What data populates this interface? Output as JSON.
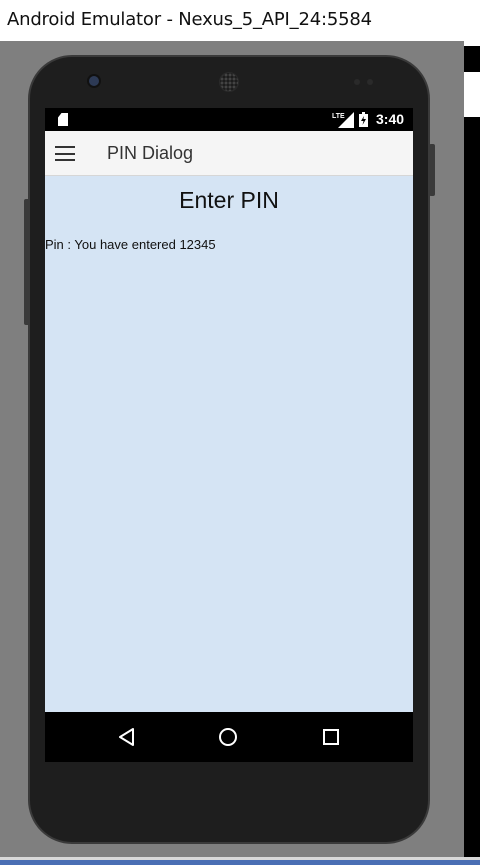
{
  "window": {
    "title": "Android Emulator - Nexus_5_API_24:5584"
  },
  "statusbar": {
    "network_label": "LTE",
    "time": "3:40"
  },
  "appbar": {
    "title": "PIN Dialog",
    "menu_icon": "hamburger-menu-icon"
  },
  "content": {
    "heading": "Enter PIN",
    "message": "Pin : You have entered 12345"
  },
  "navbar": {
    "back_icon": "back-triangle-icon",
    "home_icon": "home-circle-icon",
    "recents_icon": "recents-square-icon"
  },
  "colors": {
    "content_background": "#d5e4f4",
    "appbar_background": "#f5f5f5",
    "emulator_background": "#7f7f7f"
  }
}
